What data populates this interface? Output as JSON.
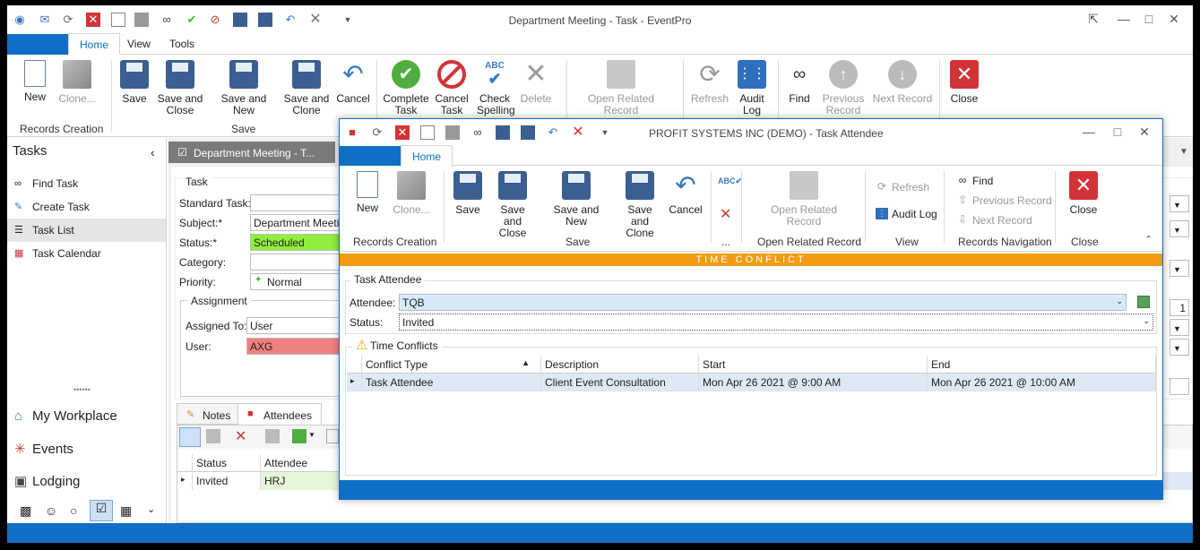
{
  "main": {
    "title": "Department Meeting - Task - EventPro",
    "tabs": [
      "Home",
      "View",
      "Tools"
    ],
    "ribbon": {
      "buttons": [
        "New",
        "Clone...",
        "Save",
        "Save and Close",
        "Save and New",
        "Save and Clone",
        "Cancel",
        "Complete Task",
        "Cancel Task",
        "Check Spelling",
        "Delete",
        "Open Related Record",
        "Refresh",
        "Audit Log",
        "Find",
        "Previous Record",
        "Next Record",
        "Close"
      ],
      "groups": [
        "Records Creation",
        "Save"
      ]
    }
  },
  "nav": {
    "title": "Tasks",
    "items": [
      "Find Task",
      "Create Task",
      "Task List",
      "Task Calendar"
    ],
    "sections": [
      "My Workplace",
      "Events",
      "Lodging"
    ],
    "splitter": "••••••"
  },
  "doc": {
    "tab": "Department Meeting - T...",
    "task_section": "Task",
    "labels": [
      "Standard Task:",
      "Subject:*",
      "Status:*",
      "Category:",
      "Priority:"
    ],
    "values": {
      "standard_task": "",
      "subject": "Department Meeting",
      "status": "Scheduled",
      "category": "",
      "priority": "Normal"
    },
    "assignment": {
      "title": "Assignment",
      "assigned_to_label": "Assigned To:",
      "assigned_to": "User",
      "user_label": "User:",
      "user": "AXG"
    },
    "subtabs": [
      "Notes",
      "Attendees"
    ],
    "grid": {
      "headers": [
        "Status",
        "Attendee"
      ],
      "rows": [
        {
          "status": "Invited",
          "attendee": "HRJ"
        }
      ]
    },
    "side_value": "1"
  },
  "dialog": {
    "title": "PROFIT SYSTEMS INC (DEMO) - Task Attendee",
    "tab": "Home",
    "buttons": [
      "New",
      "Clone...",
      "Save",
      "Save and Close",
      "Save and New",
      "Save and Clone",
      "Cancel",
      "Open Related Record",
      "Refresh",
      "Audit Log",
      "Find",
      "Previous Record",
      "Next Record",
      "Close"
    ],
    "groups": [
      "Records Creation",
      "Save",
      "...",
      "Open Related Record",
      "View",
      "Records Navigation",
      "Close"
    ],
    "conflict_banner": "TIME CONFLICT",
    "section": "Task Attendee",
    "attendee_label": "Attendee:",
    "attendee": "TQB",
    "status_label": "Status:",
    "status": "Invited",
    "conflicts": {
      "title": "Time Conflicts",
      "headers": [
        "Conflict Type",
        "Description",
        "Start",
        "End"
      ],
      "rows": [
        {
          "type": "Task Attendee",
          "description": "Client Event Consultation",
          "start": "Mon Apr 26 2021 @ 9:00 AM",
          "end": "Mon Apr 26 2021 @ 10:00 AM"
        }
      ]
    }
  },
  "colors": {
    "accent": "#0f6fc6",
    "status_fill": "#90ee3c",
    "user_fill": "#f08080",
    "conflict_bar": "#f39c12",
    "selected_row": "#dde9f5"
  }
}
